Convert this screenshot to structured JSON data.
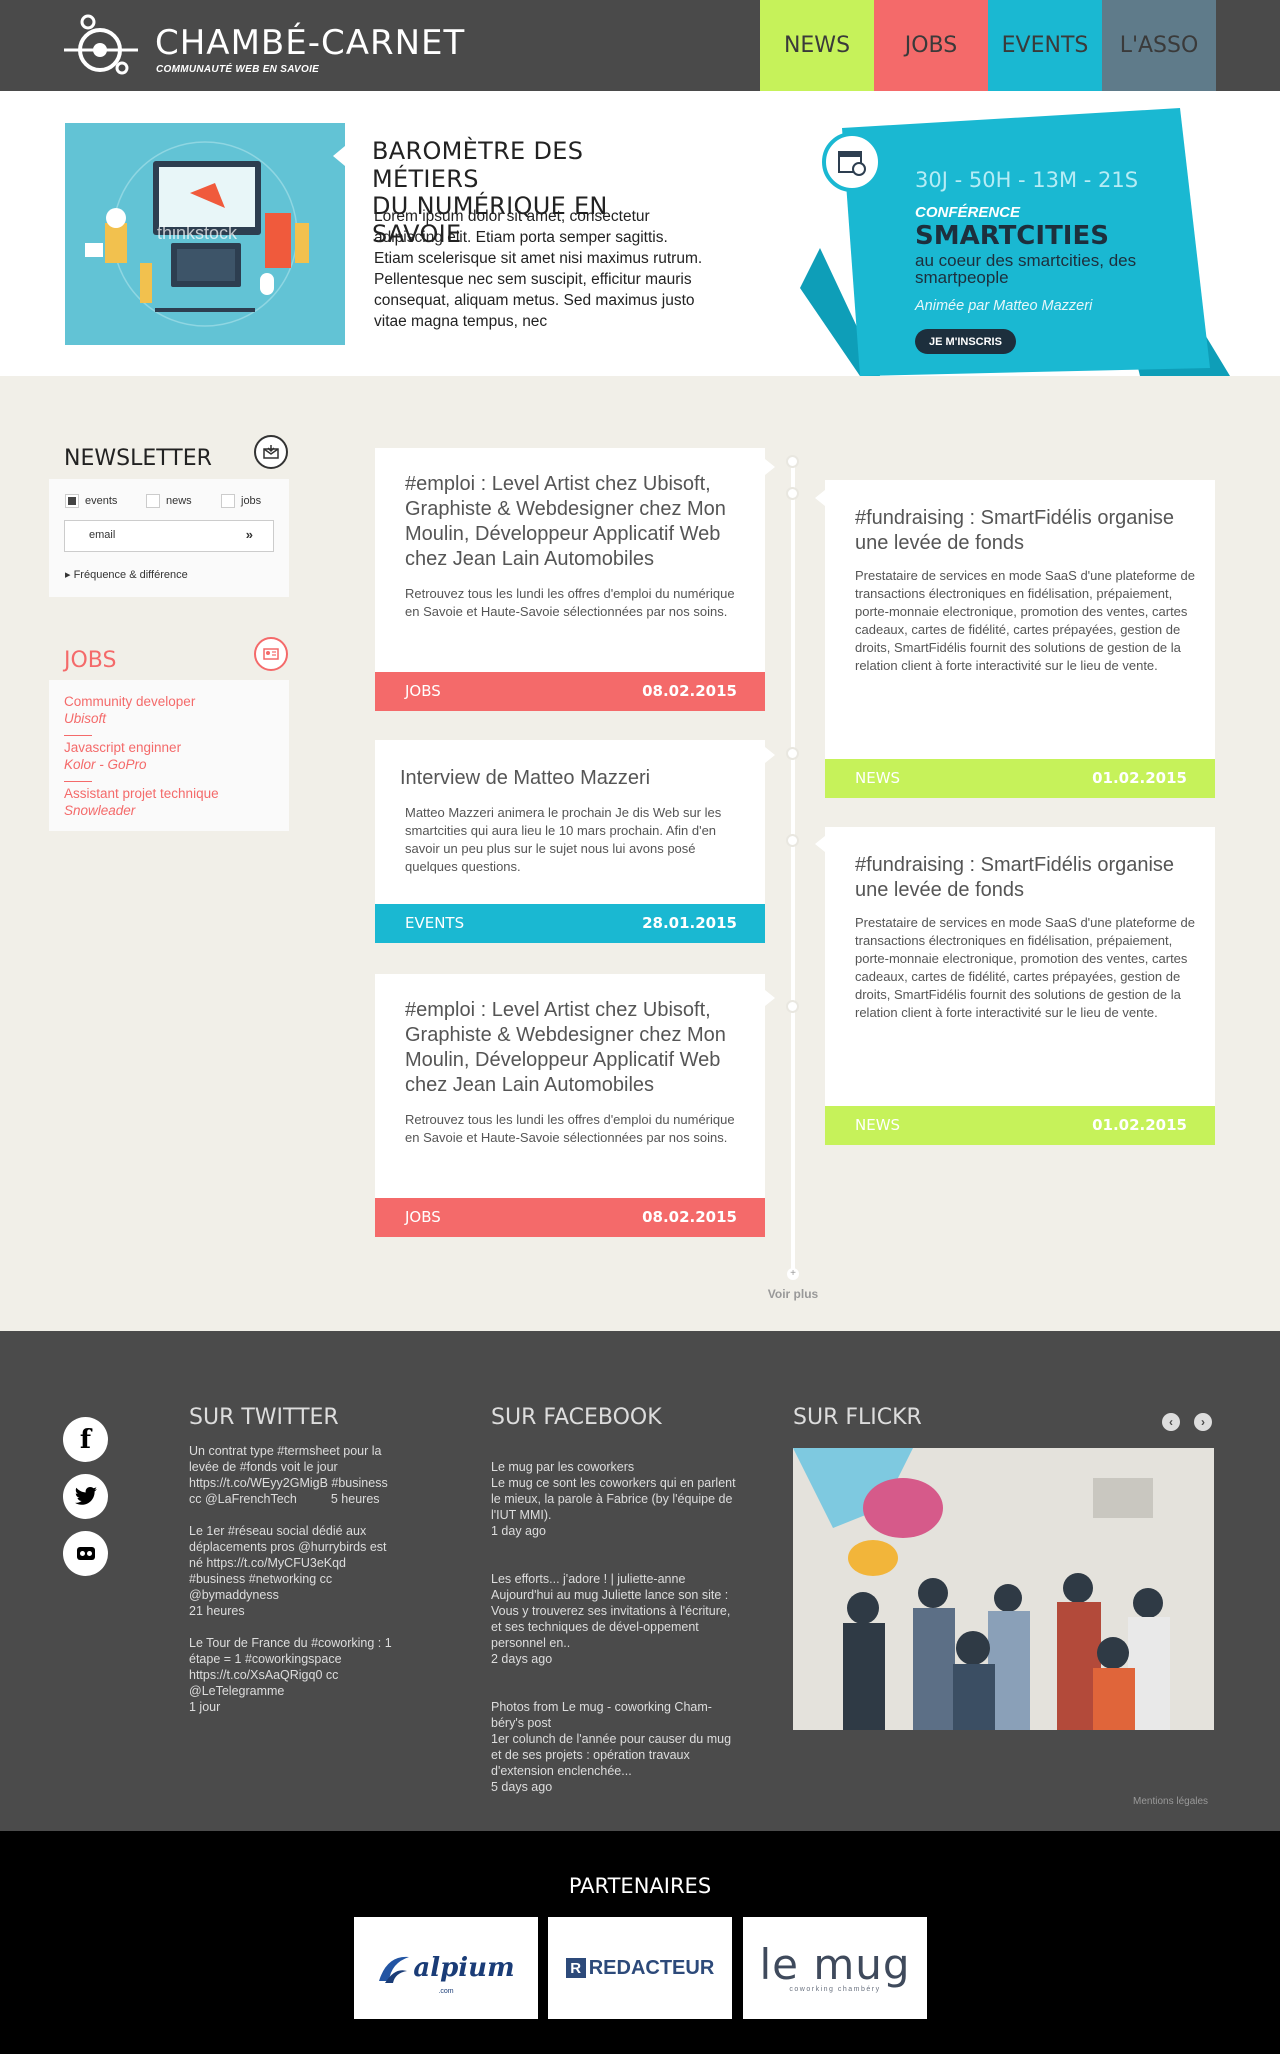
{
  "header": {
    "logo_name": "CHAMBÉ-CARNET",
    "logo_tagline": "COMMUNAUTÉ WEB EN SAVOIE",
    "nav": [
      {
        "label": "NEWS",
        "color": "#c6f25a"
      },
      {
        "label": "JOBS",
        "color": "#f46a6a"
      },
      {
        "label": "EVENTS",
        "color": "#1ab8d2"
      },
      {
        "label": "L'ASSO",
        "color": "#5f7b8a"
      }
    ]
  },
  "hero": {
    "image_watermark": "thinkstock",
    "title_line1": "BAROMÈTRE DES MÉTIERS",
    "title_line2": "DU NUMÉRIQUE EN SAVOIE",
    "text": "Lorem ipsum dolor sit amet, consectetur adipiscing elit. Etiam porta semper sagittis. Etiam scelerisque sit amet nisi maximus rutrum. Pellentesque nec sem suscipit, efficitur mauris consequat, aliquam metus. Sed maximus justo vitae magna tempus, nec"
  },
  "promo": {
    "countdown": "30J - 50H - 13M - 21S",
    "kind": "CONFÉRENCE",
    "title": "SMARTCITIES",
    "subtitle": "au coeur des smartcities, des smartpeople",
    "host": "Animée par Matteo Mazzeri",
    "cta": "JE M'INSCRIS",
    "color": "#1ab8d2",
    "dark_color": "#0e9eb8"
  },
  "newsletter": {
    "title": "NEWSLETTER",
    "options": [
      {
        "label": "events",
        "checked": true
      },
      {
        "label": "news",
        "checked": false
      },
      {
        "label": "jobs",
        "checked": false
      }
    ],
    "email_placeholder": "email",
    "frequency_link": "Fréquence & différence"
  },
  "jobs_widget": {
    "title": "JOBS",
    "items": [
      {
        "role": "Community developer",
        "company": "Ubisoft"
      },
      {
        "role": "Javascript enginner",
        "company": "Kolor - GoPro"
      },
      {
        "role": "Assistant projet technique",
        "company": "Snowleader"
      }
    ]
  },
  "timeline": {
    "cards": [
      {
        "title": "#emploi : Level Artist chez Ubisoft, Graphiste & Webdesigner chez Mon Moulin, Développeur Applicatif Web chez Jean Lain Automobiles",
        "text": "Retrouvez tous les lundi les offres d'emploi du numérique en Savoie et Haute-Savoie sélectionnées par nos soins.",
        "category": "JOBS",
        "date": "08.02.2015",
        "color": "#f46a6a"
      },
      {
        "title": "#fundraising : SmartFidélis organise une levée de fonds",
        "text": "Prestataire de services en mode SaaS d'une plateforme de transactions électroniques en fidélisation, prépaiement, porte-monnaie electronique, promotion des ventes, cartes cadeaux, cartes de fidélité, cartes prépayées, gestion de droits, SmartFidélis fournit des solutions de gestion de la relation client à forte interactivité sur le lieu de vente.",
        "category": "NEWS",
        "date": "01.02.2015",
        "color": "#c6f25a"
      },
      {
        "title": "Interview de Matteo Mazzeri",
        "text": "Matteo Mazzeri animera le prochain Je dis Web sur les smartcities qui aura lieu le 10 mars prochain. Afin d'en savoir un peu plus sur le sujet nous lui avons posé quelques questions.",
        "category": "EVENTS",
        "date": "28.01.2015",
        "color": "#1ab8d2"
      },
      {
        "title": "#fundraising : SmartFidélis organise une levée de fonds",
        "text": "Prestataire de services en mode SaaS d'une plateforme de transactions électroniques en fidélisation, prépaiement, porte-monnaie electronique, promotion des ventes, cartes cadeaux, cartes de fidélité, cartes prépayées, gestion de droits, SmartFidélis fournit des solutions de gestion de la relation client à forte interactivité sur le lieu de vente.",
        "category": "NEWS",
        "date": "01.02.2015",
        "color": "#c6f25a"
      },
      {
        "title": "#emploi : Level Artist chez Ubisoft, Graphiste & Webdesigner chez Mon Moulin, Développeur Applicatif Web chez Jean Lain Automobiles",
        "text": "Retrouvez tous les lundi les offres d'emploi du numérique en Savoie et Haute-Savoie sélectionnées par nos soins.",
        "category": "JOBS",
        "date": "08.02.2015",
        "color": "#f46a6a"
      }
    ],
    "more_label": "Voir plus"
  },
  "footer": {
    "twitter_title": "SUR TWITTER",
    "tweets": [
      {
        "text": "Un contrat type #termsheet pour la levée de #fonds voit le jour https://t.co/WEyy2GMigB #business cc @LaFrenchTech",
        "time": "5 heures"
      },
      {
        "text": " Le 1er #réseau social dédié aux déplacements pros @hurrybirds est né https://t.co/MyCFU3eKqd #business #networking cc @bymaddyness",
        "time": "21 heures"
      },
      {
        "text": "Le Tour de France du #coworking : 1 étape = 1 #coworkingspace https://t.co/XsAaQRigq0 cc @LeTelegramme",
        "time": "1 jour"
      }
    ],
    "facebook_title": "SUR FACEBOOK",
    "fb_posts": [
      {
        "text": "Le mug par les coworkers\nLe mug ce sont les coworkers qui en parlent le mieux, la parole à Fabrice (by l'équipe de l'IUT MMI).",
        "time": "1 day ago"
      },
      {
        "text": "Les efforts... j'adore ! | juliette-anne\nAujourd'hui au mug Juliette lance son site : Vous y trouverez ses invitations à l'écriture, et ses techniques de dével-oppement personnel en..",
        "time": "2 days ago"
      },
      {
        "text": "Photos from Le mug - coworking Cham-béry's post\n1er colunch de l'année pour causer du mug et de ses projets : opération travaux d'extension enclenchée...",
        "time": "5 days ago"
      }
    ],
    "flickr_title": "SUR FLICKR",
    "legal": "Mentions légales"
  },
  "partners": {
    "title": "PARTENAIRES",
    "logos": [
      "alpium",
      "REDACTEUR",
      "le mug"
    ],
    "mug_tagline": "coworking chambéry",
    "alpium_sub": ".com"
  }
}
